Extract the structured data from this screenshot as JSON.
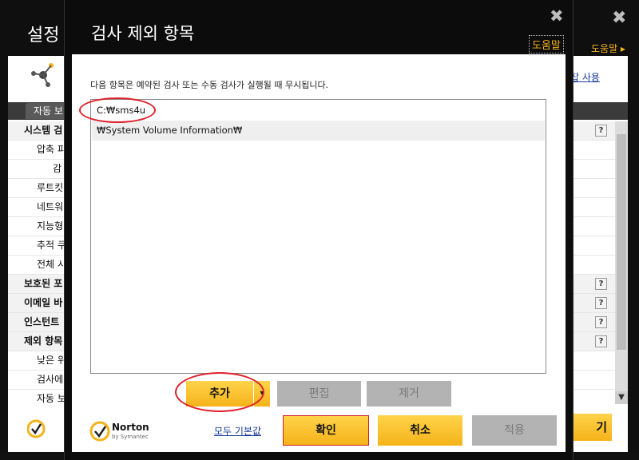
{
  "background": {
    "title": "설정",
    "help": "도움말 ▸",
    "link": "잡 사용",
    "tab": "자동 보",
    "rows": [
      {
        "label": "시스템 검",
        "bold": true,
        "help": "?"
      },
      {
        "label": "압축 피",
        "bold": false
      },
      {
        "label": "감",
        "bold": false
      },
      {
        "label": "루트킷",
        "bold": false
      },
      {
        "label": "네트워",
        "bold": false
      },
      {
        "label": "지능형",
        "bold": false
      },
      {
        "label": "추적 쿠",
        "bold": false
      },
      {
        "label": "전체 시",
        "bold": false
      },
      {
        "label": "보호된 포",
        "bold": true,
        "help": "?"
      },
      {
        "label": "이메일 바",
        "bold": true,
        "help": "?"
      },
      {
        "label": "인스턴트",
        "bold": true,
        "help": "?"
      },
      {
        "label": "제외 항목",
        "bold": true,
        "help": "?"
      },
      {
        "label": "낮은 위",
        "bold": false
      },
      {
        "label": "검사에",
        "bold": false
      },
      {
        "label": "자동 보",
        "bold": false
      }
    ],
    "close_button": "기"
  },
  "dialog": {
    "title": "검사 제외 항목",
    "help": "도움말",
    "description": "다음 항목은 예약된 검사 또는 수동 검사가 실행될 때 무시됩니다.",
    "items": [
      "C:₩sms4u",
      "₩System Volume Information₩"
    ],
    "add_label": "추가",
    "add_dropdown": "▾",
    "edit_label": "편집",
    "remove_label": "제거",
    "defaults_link": "모두 기본값",
    "ok_label": "확인",
    "cancel_label": "취소",
    "apply_label": "적용",
    "close_glyph": "✖",
    "brand": {
      "name": "Norton",
      "sub": "by Symantec",
      "check_color": "#f5b31a"
    }
  }
}
